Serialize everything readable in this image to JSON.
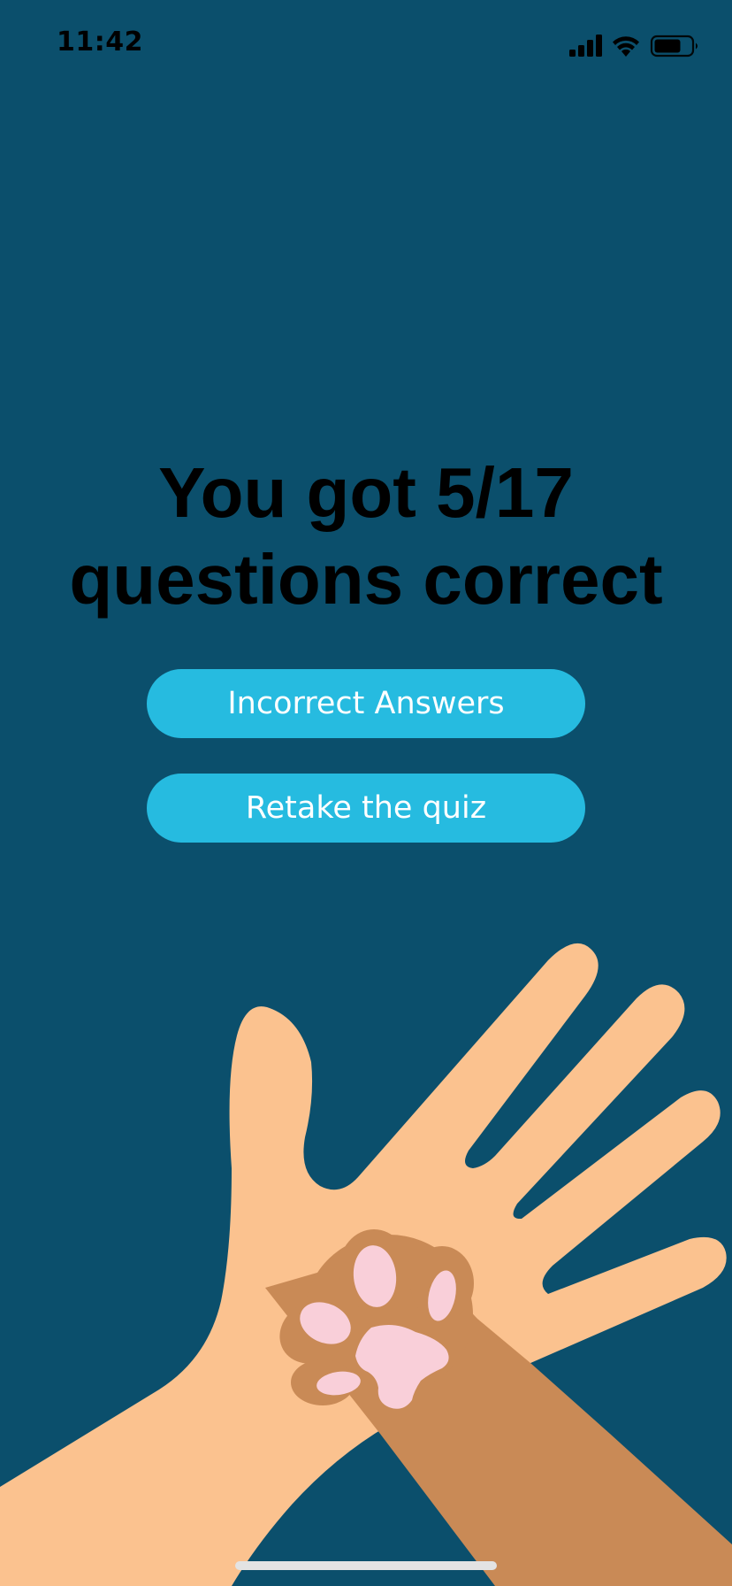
{
  "status_bar": {
    "time": "11:42",
    "icons": [
      "cellular-signal-icon",
      "wifi-icon",
      "battery-icon"
    ]
  },
  "result": {
    "line1": "You got 5/17",
    "line2": "questions correct",
    "score_correct": 5,
    "score_total": 17
  },
  "buttons": {
    "incorrect_answers_label": "Incorrect Answers",
    "retake_label": "Retake the quiz"
  },
  "illustration": {
    "name": "hand-with-cat-paw-illustration"
  },
  "colors": {
    "background": "#0b4f6c",
    "button": "#26bbe0",
    "button_text": "#ffffff",
    "hand": "#fbc28f",
    "paw": "#c98a56",
    "paw_pads": "#f9cfd9"
  }
}
